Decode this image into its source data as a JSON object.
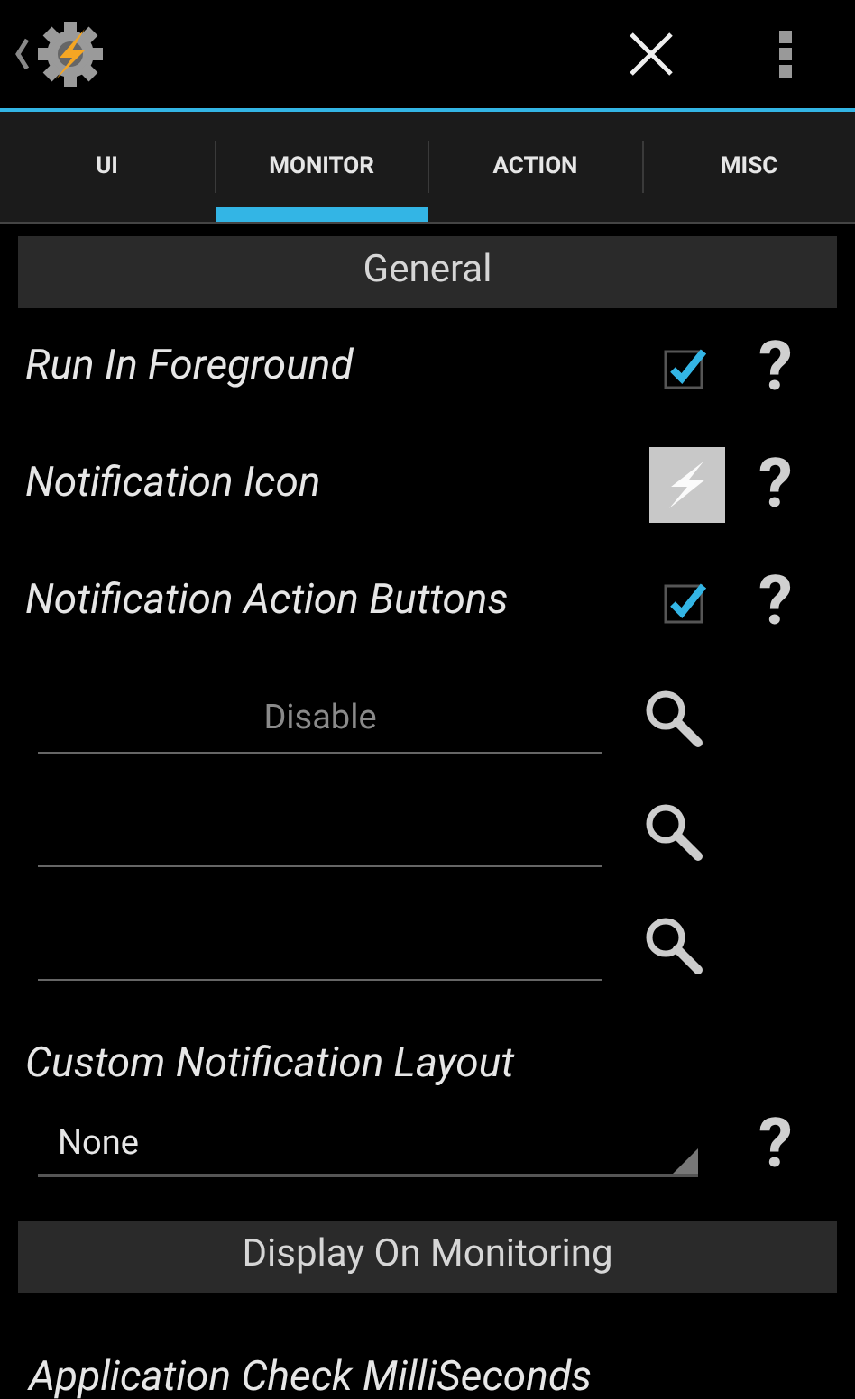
{
  "tabs": [
    {
      "label": "UI",
      "selected": false
    },
    {
      "label": "MONITOR",
      "selected": true
    },
    {
      "label": "ACTION",
      "selected": false
    },
    {
      "label": "MISC",
      "selected": false
    }
  ],
  "general": {
    "title": "General",
    "settings": [
      {
        "kind": "checkbox",
        "label": "Run In Foreground",
        "checked": true,
        "help": "?"
      },
      {
        "kind": "icon",
        "label": "Notification Icon",
        "help": "?"
      },
      {
        "kind": "checkbox",
        "label": "Notification Action Buttons",
        "checked": true,
        "help": "?"
      }
    ],
    "action_fields": [
      {
        "kind": "hinted",
        "placeholder": "Disable"
      },
      {
        "kind": "blank"
      },
      {
        "kind": "blank"
      }
    ],
    "layout": {
      "label": "Custom Notification Layout",
      "value": "None",
      "help": "?"
    }
  },
  "display": {
    "title": "Display On Monitoring",
    "first_setting": "Application Check MilliSeconds"
  }
}
